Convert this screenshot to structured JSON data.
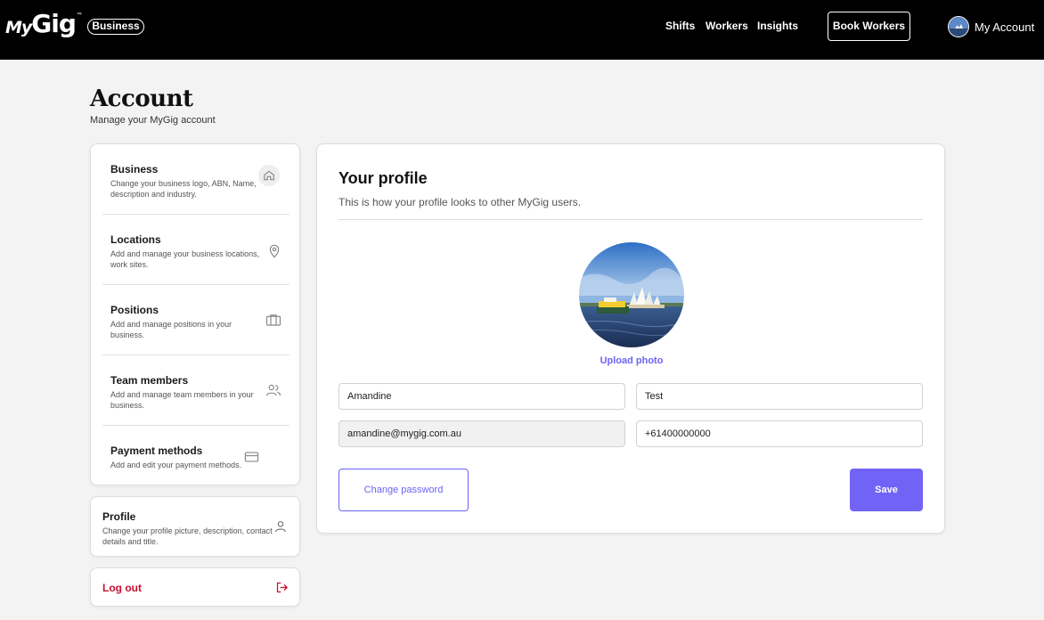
{
  "header": {
    "logo_my": "My",
    "logo_gig": "Gig",
    "logo_tm": "™",
    "badge": "Business",
    "nav": [
      "Shifts",
      "Workers",
      "Insights"
    ],
    "book_button": "Book Workers",
    "account_label": "My Account"
  },
  "page": {
    "title": "Account",
    "subtitle": "Manage your MyGig account"
  },
  "sidebar": {
    "items": [
      {
        "title": "Business",
        "description": "Change your business logo, ABN, Name, description and industry.",
        "icon": "home-icon"
      },
      {
        "title": "Locations",
        "description": "Add and manage your business locations, work sites.",
        "icon": "map-pin-icon"
      },
      {
        "title": "Positions",
        "description": "Add and manage positions in your business.",
        "icon": "briefcase-icon"
      },
      {
        "title": "Team members",
        "description": "Add and manage team members in your business.",
        "icon": "users-icon"
      },
      {
        "title": "Payment methods",
        "description": "Add and edit your payment methods.",
        "icon": "credit-card-icon"
      }
    ],
    "profile": {
      "title": "Profile",
      "description": "Change your profile picture, description, contact details and title.",
      "icon": "user-icon"
    },
    "logout": {
      "label": "Log out",
      "icon": "logout-icon"
    }
  },
  "profile": {
    "title": "Your profile",
    "subtitle": "This is how your profile looks to other MyGig users.",
    "upload_label": "Upload photo",
    "first_name": "Amandine",
    "last_name": "Test",
    "email": "amandine@mygig.com.au",
    "phone": "+61400000000",
    "change_password_label": "Change password",
    "save_label": "Save"
  },
  "colors": {
    "accent": "#6c63f5",
    "logout": "#c8102e",
    "header_bg": "#000000",
    "page_bg": "#f3f3f4"
  }
}
